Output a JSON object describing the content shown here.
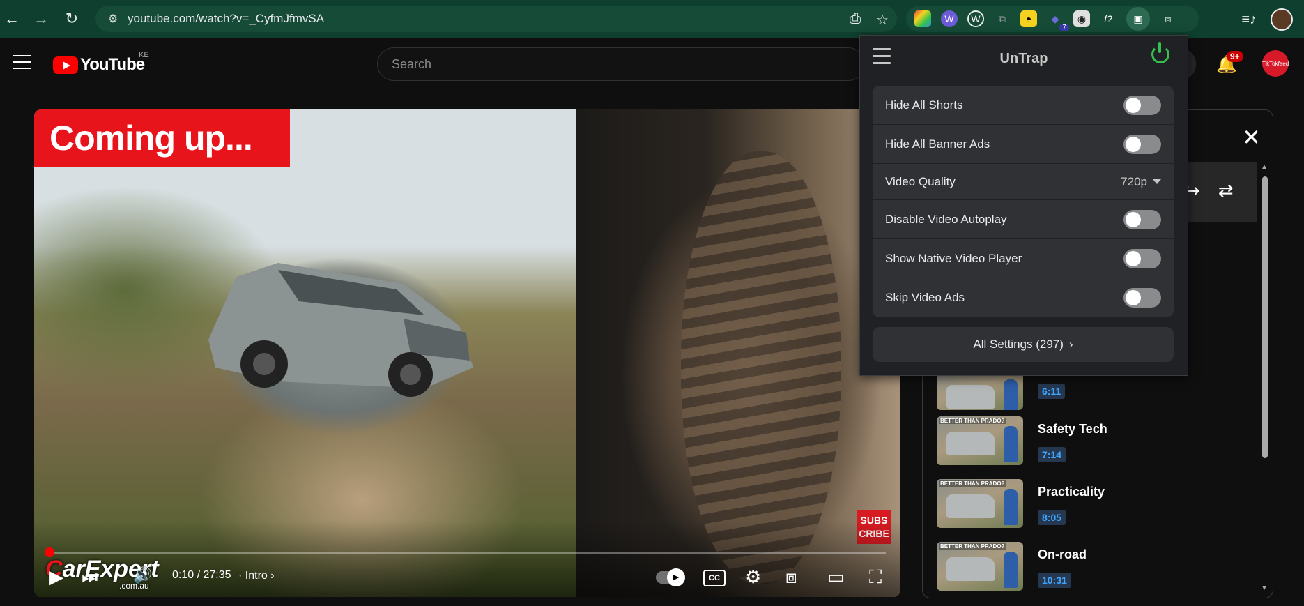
{
  "browser": {
    "url": "youtube.com/watch?v=_CyfmJfmvSA",
    "extensions": [
      {
        "name": "color-palette-ext",
        "glyph": "▦",
        "color": "#e2b33a"
      },
      {
        "name": "wordtune-ext",
        "glyph": "Ⓦ",
        "color": "#6b5bd6"
      },
      {
        "name": "wordpress-ext",
        "glyph": "Ⓦ",
        "color": "#3a3a3a"
      },
      {
        "name": "copy-ext",
        "glyph": "⧉",
        "color": "#5f6368"
      },
      {
        "name": "glasses-ext",
        "glyph": "◓",
        "color": "#f4d21f"
      },
      {
        "name": "vpn-ext",
        "glyph": "◆",
        "color": "#3a3aa8",
        "badge": "7"
      },
      {
        "name": "ghost-ext",
        "glyph": "◉",
        "color": "#d0d0d0"
      },
      {
        "name": "formula-ext",
        "glyph": "f?",
        "color": "#ffffff"
      },
      {
        "name": "untrap-ext",
        "glyph": "▣",
        "color": "#2d6a52"
      },
      {
        "name": "puzzle-ext",
        "glyph": "⧈",
        "color": "#e8eaed"
      }
    ]
  },
  "youtube": {
    "logo_text": "YouTube",
    "country": "KE",
    "search_placeholder": "Search",
    "notifications": "9+",
    "avatar_text": "TikTokfeed"
  },
  "player": {
    "banner": "Coming up...",
    "subscribe": "SUBS CRIBE",
    "time": "0:10 / 27:35",
    "chapter": "· Intro",
    "progress": 0.006,
    "brand_first": "C",
    "brand_rest": "arExpert",
    "brand_sub": ".com.au"
  },
  "panel": {
    "chapters": [
      {
        "title": "",
        "time": "6:11",
        "top": 0
      },
      {
        "title": "Safety Tech",
        "time": "7:14"
      },
      {
        "title": "Practicality",
        "time": "8:05"
      },
      {
        "title": "On-road",
        "time": "10:31"
      }
    ],
    "thumb_text": "BETTER THAN PRADO?"
  },
  "untrap": {
    "title": "UnTrap",
    "rows": [
      {
        "label": "Hide All Shorts",
        "type": "toggle",
        "on": false
      },
      {
        "label": "Hide All Banner Ads",
        "type": "toggle",
        "on": false
      },
      {
        "label": "Video Quality",
        "type": "select",
        "value": "720p"
      },
      {
        "label": "Disable Video Autoplay",
        "type": "toggle",
        "on": false
      },
      {
        "label": "Show Native Video Player",
        "type": "toggle",
        "on": false
      },
      {
        "label": "Skip Video Ads",
        "type": "toggle",
        "on": false
      }
    ],
    "all_settings": "All Settings (297)"
  }
}
